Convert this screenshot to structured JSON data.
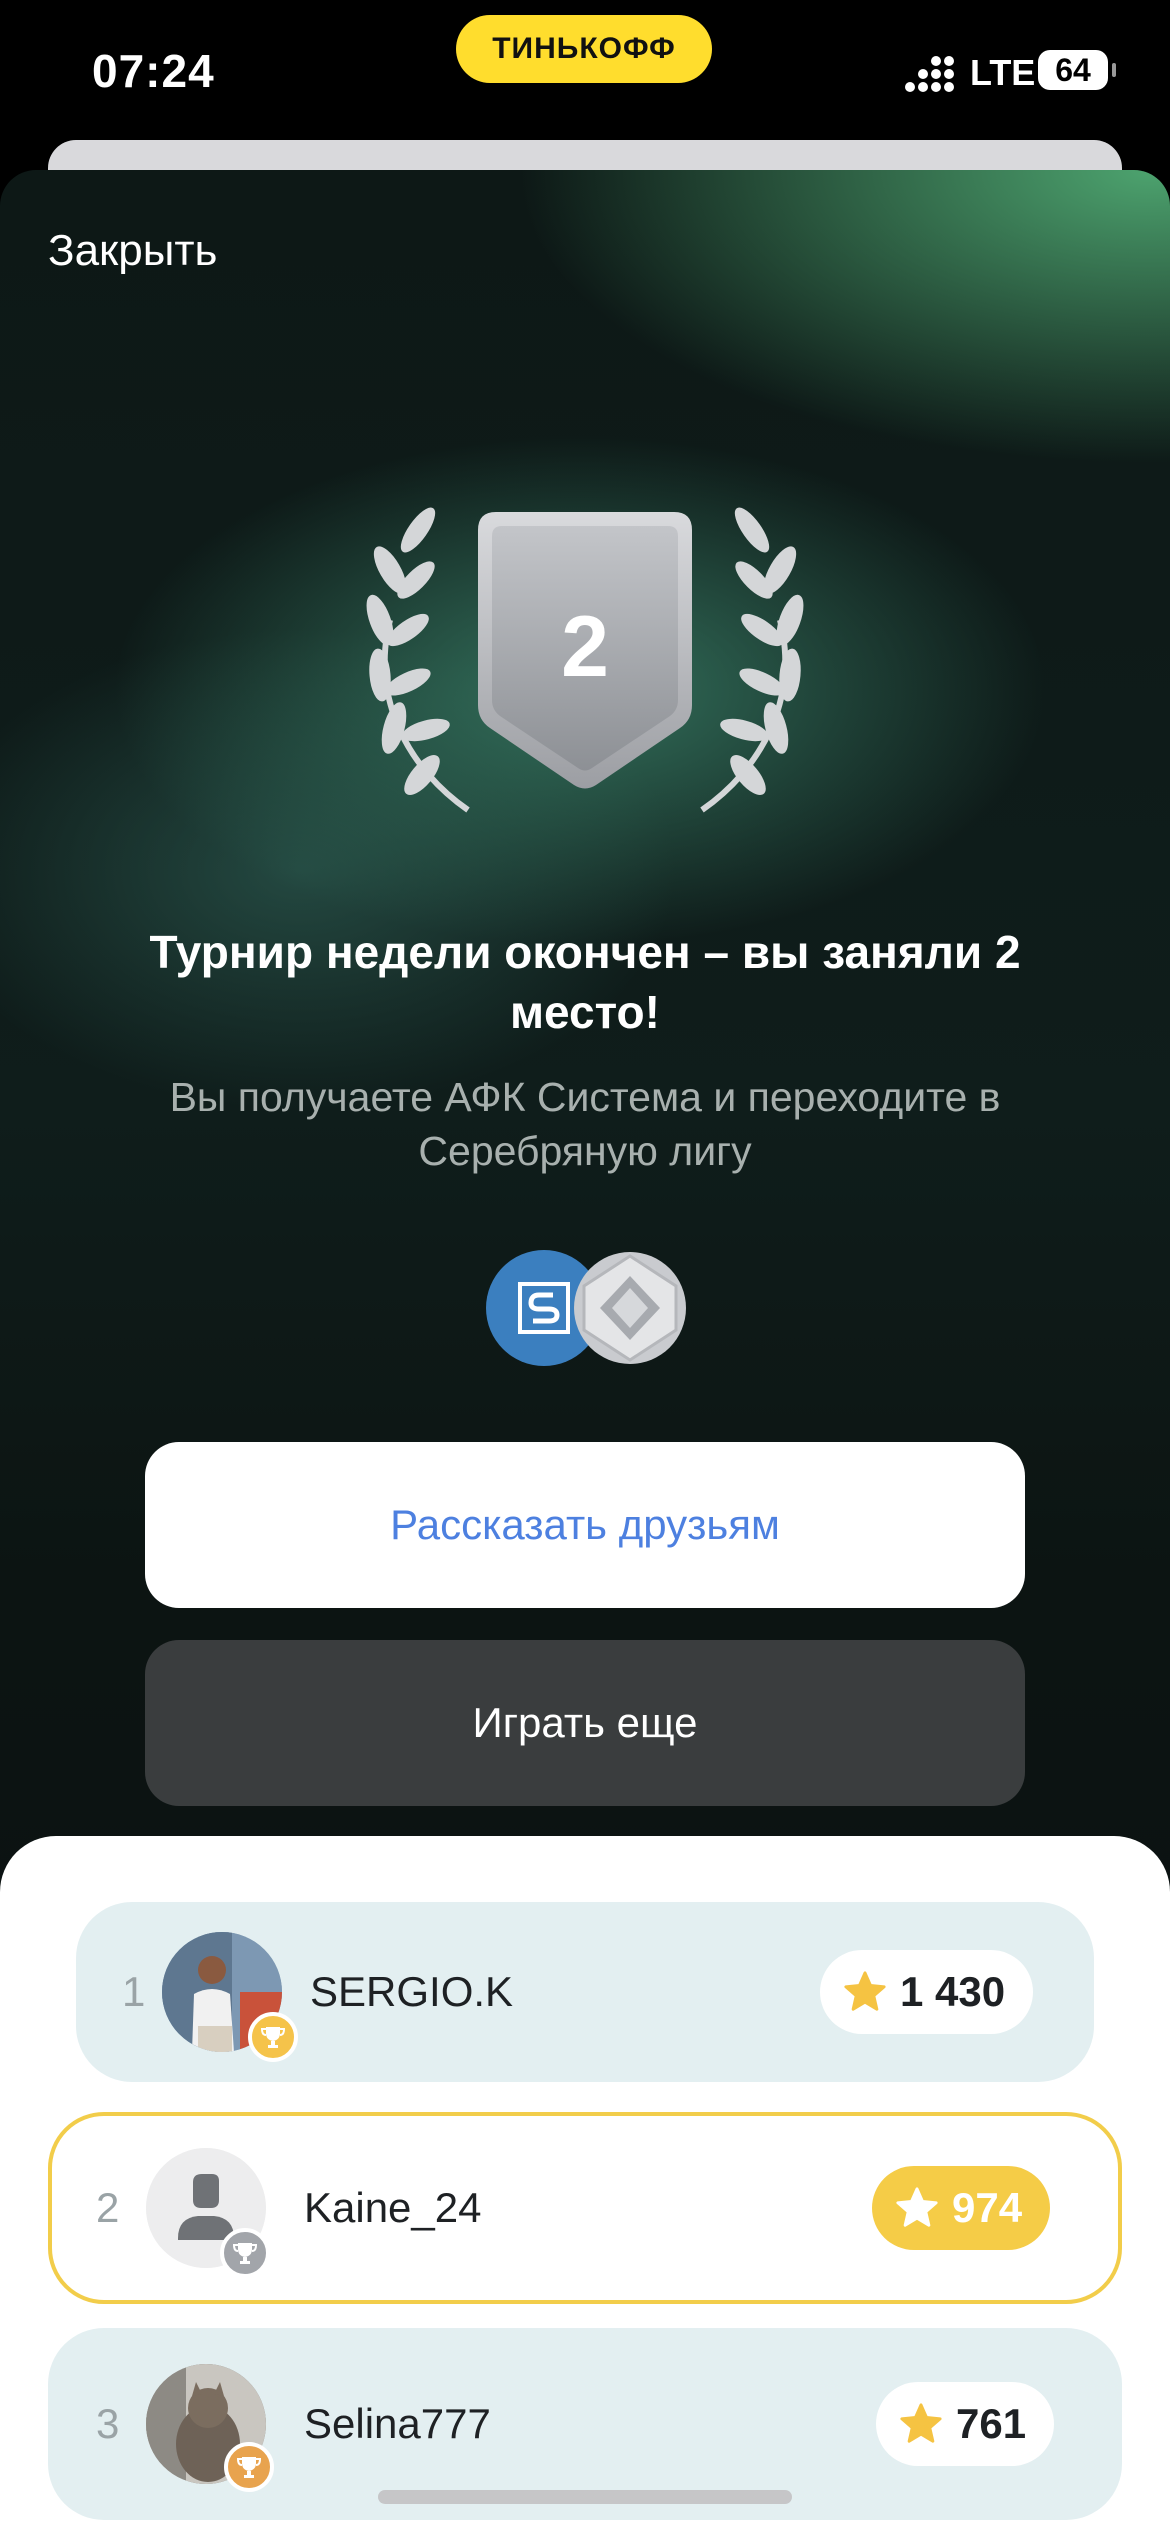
{
  "status_bar": {
    "time": "07:24",
    "bank": "ТИНЬКОФФ",
    "network": "LTE",
    "battery": "64"
  },
  "modal": {
    "close_label": "Закрыть",
    "place": "2",
    "title": "Турнир недели окончен – вы заняли 2 место!",
    "subtitle": "Вы получаете АФК Система и переходите в Серебряную лигу",
    "share_button": "Рассказать друзьям",
    "play_again_button": "Играть еще"
  },
  "leaderboard": [
    {
      "rank": "1",
      "name": "SERGIO.K",
      "score": "1 430",
      "badge": "gold-trophy"
    },
    {
      "rank": "2",
      "name": "Kaine_24",
      "score": "974",
      "badge": "silver-trophy",
      "current_user": true
    },
    {
      "rank": "3",
      "name": "Selina777",
      "score": "761",
      "badge": "bronze-trophy"
    }
  ],
  "colors": {
    "accent_yellow": "#ffdd2d",
    "link_blue": "#4d80e0",
    "gold": "#f5cc47",
    "row_bg": "#e3eff1"
  }
}
